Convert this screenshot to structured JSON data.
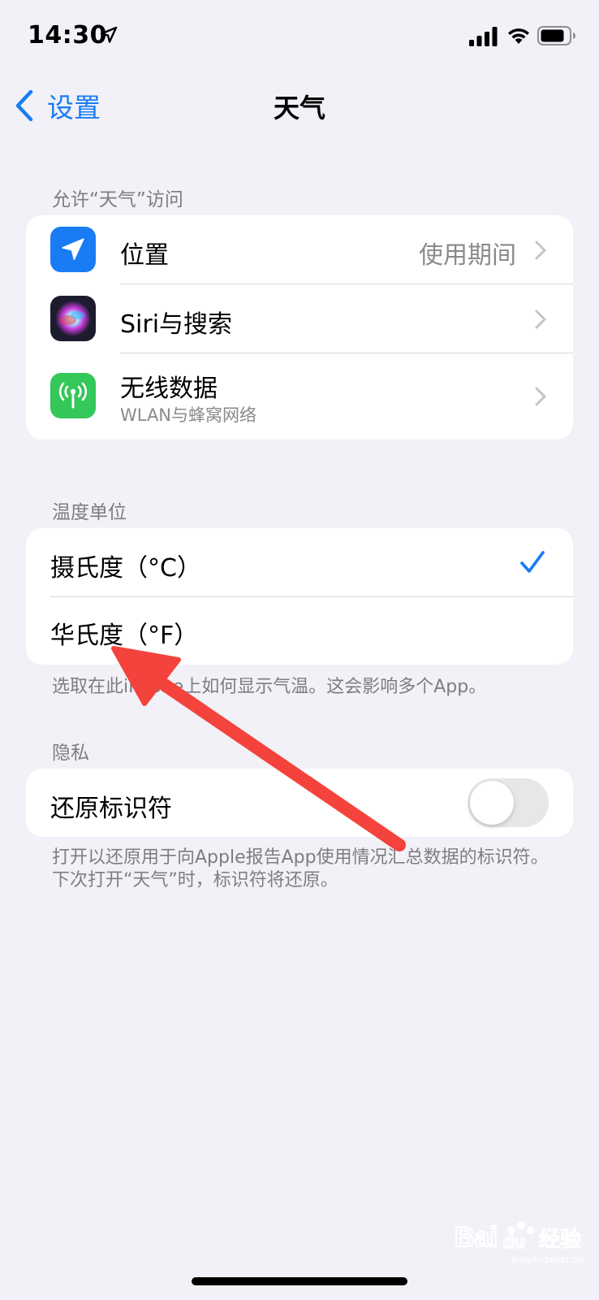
{
  "status_bar": {
    "time": "14:30",
    "icons": [
      "location-arrow-icon",
      "cellular-signal-icon",
      "wifi-icon",
      "battery-icon"
    ]
  },
  "nav": {
    "back_label": "设置",
    "title": "天气"
  },
  "sections": {
    "access": {
      "header": "允许“天气”访问",
      "rows": [
        {
          "title": "位置",
          "value": "使用期间",
          "icon": "location-icon",
          "icon_color": "#1a7cf5"
        },
        {
          "title": "Siri与搜索",
          "icon": "siri-icon"
        },
        {
          "title": "无线数据",
          "subtitle": "WLAN与蜂窝网络",
          "icon": "antenna-icon",
          "icon_color": "#34c759"
        }
      ]
    },
    "units": {
      "header": "温度单位",
      "rows": [
        {
          "title": "摄氏度（°C）",
          "selected": true
        },
        {
          "title": "华氏度（°F）",
          "selected": false
        }
      ],
      "footer": "选取在此iPhone上如何显示气温。这会影响多个App。"
    },
    "privacy": {
      "header": "隐私",
      "rows": [
        {
          "title": "还原标识符",
          "toggle": false
        }
      ],
      "footer": "打开以还原用于向Apple报告App使用情况汇总数据的标识符。下次打开“天气”时，标识符将还原。"
    }
  },
  "colors": {
    "accent": "#1a7cf5",
    "background": "#f2f1f7",
    "annotation_arrow": "#f4433c"
  },
  "watermark": {
    "logo_text": "Bai du 经验",
    "sub_text": "jingyan.baidu.com"
  }
}
